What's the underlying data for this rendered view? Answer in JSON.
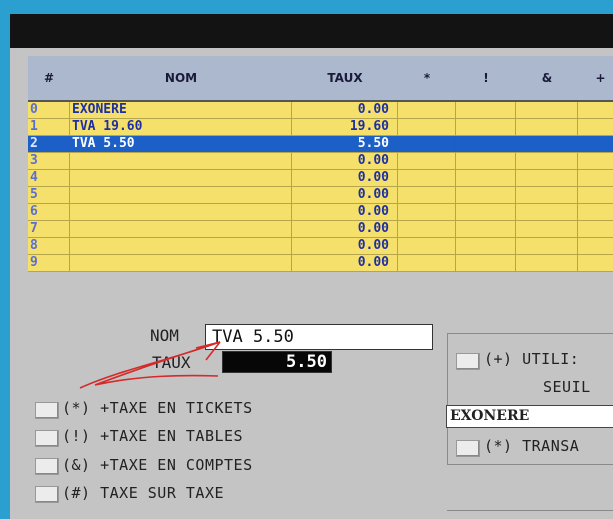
{
  "table": {
    "headers": [
      "#",
      "NOM",
      "TAUX",
      "*",
      "!",
      "&",
      "+"
    ],
    "rows": [
      {
        "num": "0",
        "nom": "EXONERE",
        "taux": "0.00",
        "selected": false
      },
      {
        "num": "1",
        "nom": "TVA 19.60",
        "taux": "19.60",
        "selected": false
      },
      {
        "num": "2",
        "nom": "TVA 5.50",
        "taux": "5.50",
        "selected": true
      },
      {
        "num": "3",
        "nom": "",
        "taux": "0.00",
        "selected": false
      },
      {
        "num": "4",
        "nom": "",
        "taux": "0.00",
        "selected": false
      },
      {
        "num": "5",
        "nom": "",
        "taux": "0.00",
        "selected": false
      },
      {
        "num": "6",
        "nom": "",
        "taux": "0.00",
        "selected": false
      },
      {
        "num": "7",
        "nom": "",
        "taux": "0.00",
        "selected": false
      },
      {
        "num": "8",
        "nom": "",
        "taux": "0.00",
        "selected": false
      },
      {
        "num": "9",
        "nom": "",
        "taux": "0.00",
        "selected": false
      }
    ]
  },
  "form": {
    "nom_label": "NOM",
    "nom_value": "TVA 5.50",
    "taux_label": "TAUX",
    "taux_value": "5.50",
    "checkboxes": [
      {
        "label": "(*) +TAXE EN TICKETS"
      },
      {
        "label": "(!) +TAXE EN TABLES"
      },
      {
        "label": "(&) +TAXE EN COMPTES"
      },
      {
        "label": "(#) TAXE SUR TAXE"
      }
    ],
    "right": {
      "util_label": "(+) UTILI:",
      "seuil_label": "SEUIL",
      "select_value": "EXONERE",
      "transa_label": "(*) TRANSA"
    }
  },
  "colors": {
    "row_bg": "#f4e06a",
    "selected_bg": "#1c5fc6",
    "header_bg": "#abb8cd",
    "text": "#1e2fa4"
  }
}
